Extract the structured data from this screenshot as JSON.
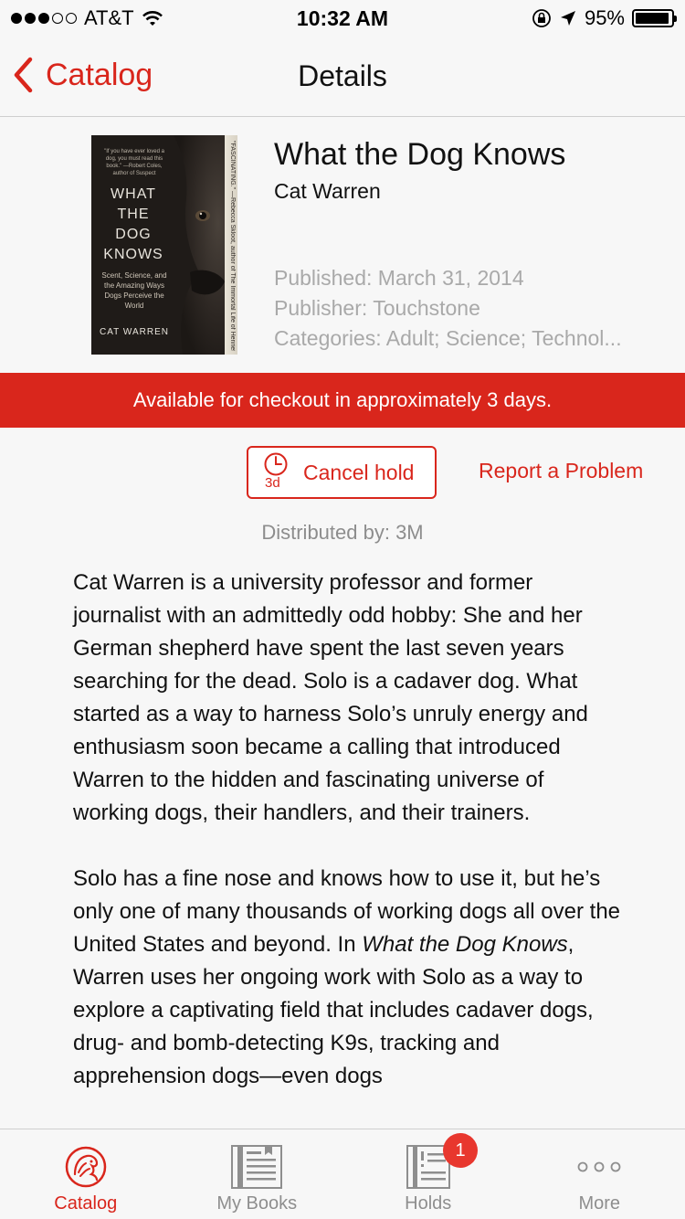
{
  "status_bar": {
    "carrier": "AT&T",
    "time": "10:32 AM",
    "battery_percent": "95%",
    "battery_level": 0.95,
    "signal_bars_filled": 3,
    "signal_bars_total": 5
  },
  "nav": {
    "back_label": "Catalog",
    "title": "Details"
  },
  "book": {
    "title": "What the Dog Knows",
    "author": "Cat Warren",
    "published": "Published: March 31, 2014",
    "publisher": "Publisher: Touchstone",
    "categories": "Categories: Adult; Science; Technol...",
    "cover": {
      "quote": "\"If you have ever loved a dog, you must read this book.\" —Robert Coles, author of Suspect",
      "title_lines": [
        "WHAT",
        "THE",
        "DOG",
        "KNOWS"
      ],
      "subtitle": "Scent, Science, and the Amazing Ways Dogs Perceive the World",
      "author": "CAT WARREN",
      "spine_text": "\"FASCINATING.\" —Rebecca Skloot, author of The Immortal Life of Henrietta Lacks"
    }
  },
  "availability_banner": "Available for checkout in approximately 3 days.",
  "actions": {
    "hold_days": "3d",
    "cancel_hold_label": "Cancel hold",
    "report_label": "Report a Problem"
  },
  "distributed_by": "Distributed by: 3M",
  "description": {
    "paragraph1": "Cat Warren is a university professor and former journalist with an admittedly odd hobby: She and her German shepherd have spent the last seven years searching for the dead. Solo is a cadaver dog. What started as a way to harness Solo’s un­ruly energy and enthusiasm soon became a call­ing that introduced Warren to the hidden and fas­cinating universe of working dogs, their handlers, and their trainers.",
    "paragraph2_start": "Solo has a fine nose and knows how to use it, but he’s only one of many thousands of working dogs all over the United States and beyond. In ",
    "paragraph2_italic": "What the Dog Knows",
    "paragraph2_end": ", Warren uses her ongoing work with Solo as a way to explore a captivating field that in­cludes cadaver dogs, drug- and bomb-detecting K9s, tracking and apprehension dogs—even dogs"
  },
  "tabs": [
    {
      "label": "Catalog",
      "icon": "lion-logo-icon",
      "active": true
    },
    {
      "label": "My Books",
      "icon": "books-icon",
      "active": false
    },
    {
      "label": "Holds",
      "icon": "holds-icon",
      "active": false,
      "badge": "1"
    },
    {
      "label": "More",
      "icon": "more-dots-icon",
      "active": false
    }
  ],
  "colors": {
    "accent": "#d9261c",
    "badge": "#e8372e",
    "muted_text": "#a9a9a9",
    "tab_inactive": "#8e8e8e"
  }
}
